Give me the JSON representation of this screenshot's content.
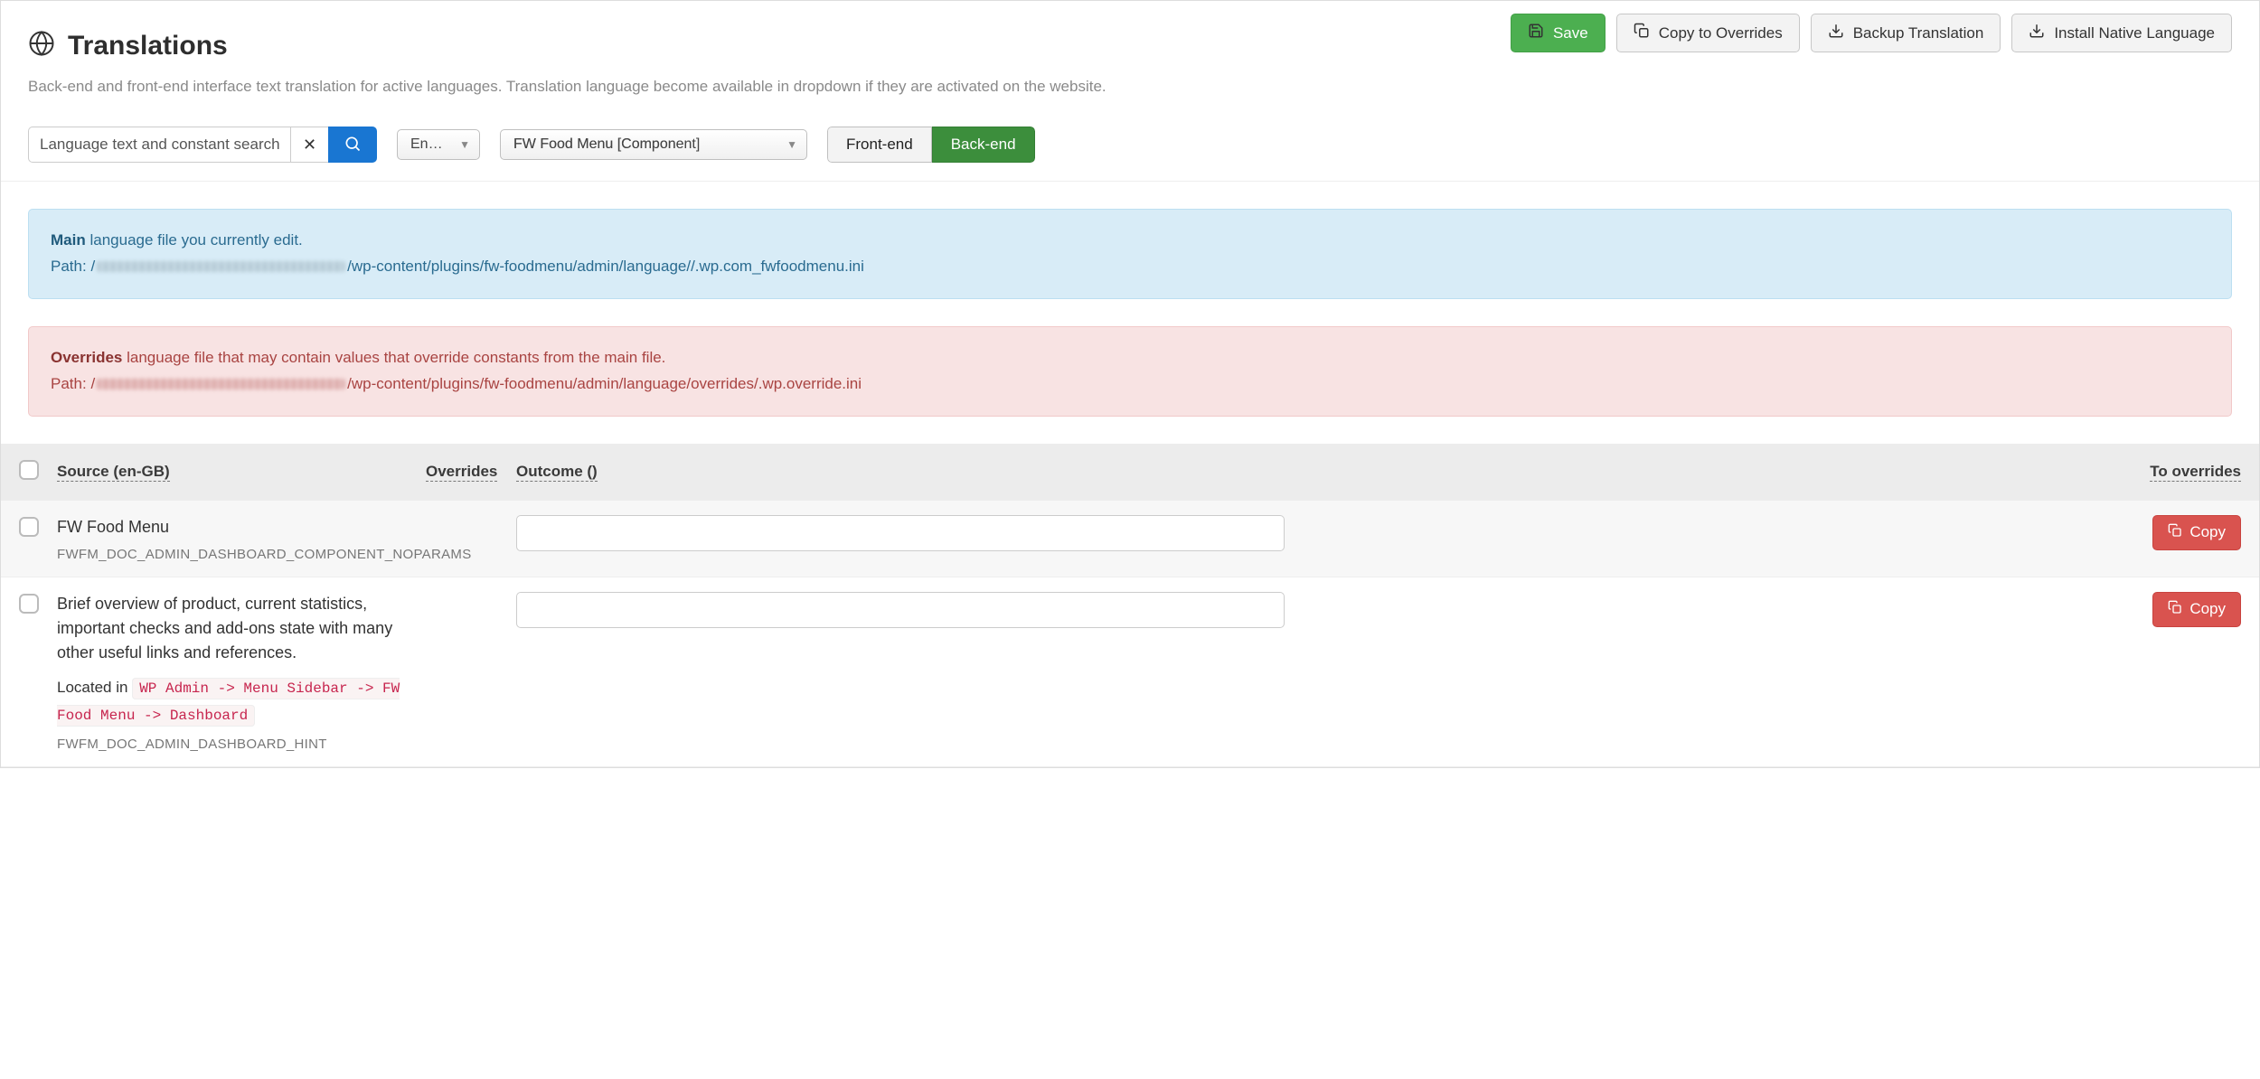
{
  "header": {
    "title": "Translations",
    "subtitle": "Back-end and front-end interface text translation for active languages. Translation language become available in dropdown if they are activated on the website.",
    "actions": {
      "save": "Save",
      "copy_overrides": "Copy to Overrides",
      "backup": "Backup Translation",
      "install": "Install Native Language"
    }
  },
  "filters": {
    "search_placeholder": "Language text and constant search",
    "language_select": "En…",
    "component_select": "FW Food Menu [Component]",
    "toggle_front": "Front-end",
    "toggle_back": "Back-end",
    "active_toggle": "back"
  },
  "alerts": {
    "main": {
      "strong": "Main",
      "text": "language file you currently edit.",
      "path_label": "Path:",
      "path_prefix": "/",
      "path_suffix": "/wp-content/plugins/fw-foodmenu/admin/language//.wp.com_fwfoodmenu.ini"
    },
    "overrides": {
      "strong": "Overrides",
      "text": "language file that may contain values that override constants from the main file.",
      "path_label": "Path:",
      "path_prefix": "/",
      "path_suffix": "/wp-content/plugins/fw-foodmenu/admin/language/overrides/.wp.override.ini"
    }
  },
  "columns": {
    "source": "Source (en-GB)",
    "overrides": "Overrides",
    "outcome": "Outcome ()",
    "to_overrides": "To overrides"
  },
  "rows": [
    {
      "source": "FW Food Menu",
      "constant": "FWFM_DOC_ADMIN_DASHBOARD_COMPONENT_NOPARAMS",
      "outcome": "",
      "copy_label": "Copy"
    },
    {
      "source": "Brief overview of product, current statistics, important checks and add-ons state with many other useful links and references.",
      "located_label": "Located in",
      "located_path": "WP Admin -> Menu Sidebar -> FW Food Menu -> Dashboard",
      "constant": "FWFM_DOC_ADMIN_DASHBOARD_HINT",
      "outcome": "",
      "copy_label": "Copy"
    }
  ]
}
